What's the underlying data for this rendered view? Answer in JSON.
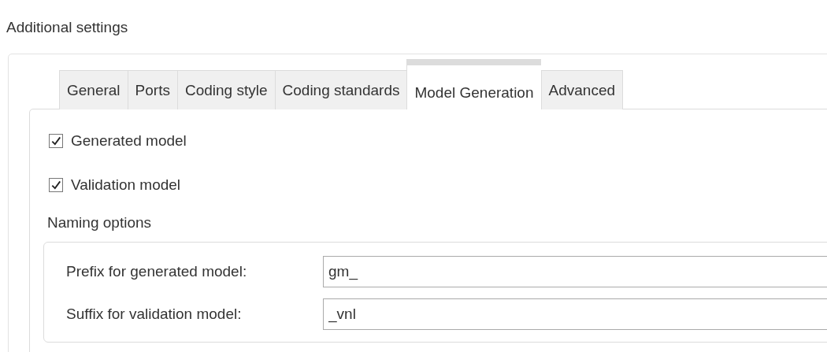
{
  "section_title": "Additional settings",
  "tabs": [
    {
      "label": "General",
      "selected": false
    },
    {
      "label": "Ports",
      "selected": false
    },
    {
      "label": "Coding style",
      "selected": false
    },
    {
      "label": "Coding standards",
      "selected": false
    },
    {
      "label": "Model Generation",
      "selected": true
    },
    {
      "label": "Advanced",
      "selected": false
    }
  ],
  "checkboxes": [
    {
      "label": "Generated model",
      "checked": true
    },
    {
      "label": "Validation model",
      "checked": true
    }
  ],
  "naming_options": {
    "title": "Naming options",
    "fields": [
      {
        "label": "Prefix for generated model:",
        "value": "gm_"
      },
      {
        "label": "Suffix for validation model:",
        "value": "_vnl"
      }
    ]
  }
}
